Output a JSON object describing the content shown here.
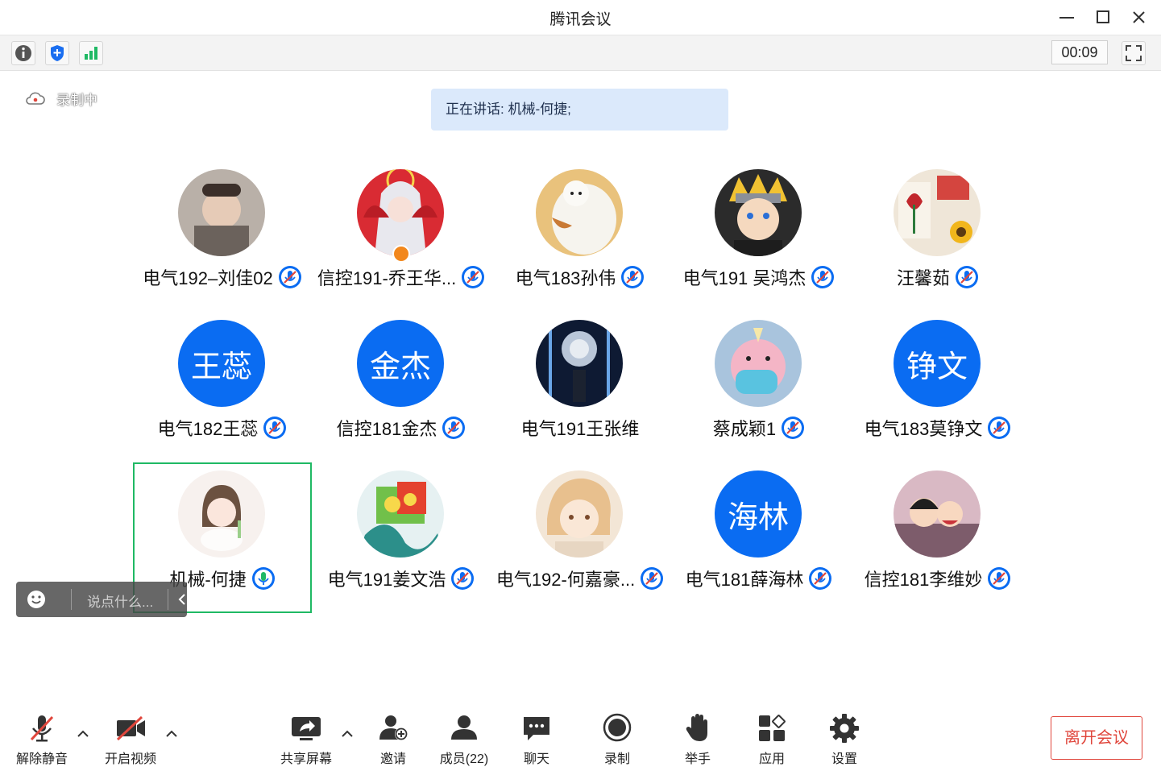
{
  "window": {
    "title": "腾讯会议"
  },
  "infobar": {
    "timer": "00:09"
  },
  "recording": {
    "label": "录制中"
  },
  "speaking": {
    "text": "正在讲话: 机械-何捷;"
  },
  "participants": [
    {
      "name": "电气192–刘佳02",
      "initials": "",
      "mic": "muted"
    },
    {
      "name": "信控191-乔王华...",
      "initials": "",
      "mic": "muted"
    },
    {
      "name": "电气183孙伟",
      "initials": "",
      "mic": "muted"
    },
    {
      "name": "电气191 吴鸿杰",
      "initials": "",
      "mic": "muted"
    },
    {
      "name": "汪馨茹",
      "initials": "",
      "mic": "muted"
    },
    {
      "name": "电气182王蕊",
      "initials": "王蕊",
      "mic": "muted"
    },
    {
      "name": "信控181金杰",
      "initials": "金杰",
      "mic": "muted"
    },
    {
      "name": "电气191王张维",
      "initials": "",
      "mic": "none"
    },
    {
      "name": "蔡成颖1",
      "initials": "",
      "mic": "muted"
    },
    {
      "name": "电气183莫铮文",
      "initials": "铮文",
      "mic": "muted"
    },
    {
      "name": "机械-何捷",
      "initials": "",
      "mic": "speaking"
    },
    {
      "name": "电气191姜文浩",
      "initials": "",
      "mic": "muted"
    },
    {
      "name": "电气192-何嘉豪...",
      "initials": "",
      "mic": "muted"
    },
    {
      "name": "电气181薛海林",
      "initials": "海林",
      "mic": "muted"
    },
    {
      "name": "信控181李维妙",
      "initials": "",
      "mic": "muted"
    }
  ],
  "chat": {
    "placeholder": "说点什么..."
  },
  "toolbar": {
    "unmute": "解除静音",
    "start_video": "开启视频",
    "share_screen": "共享屏幕",
    "invite": "邀请",
    "members": "成员(22)",
    "chat": "聊天",
    "record": "录制",
    "raise_hand": "举手",
    "apps": "应用",
    "settings": "设置",
    "leave": "离开会议"
  },
  "colors": {
    "accent_blue": "#0a6cf2",
    "active_speaker_border": "#1fb964",
    "leave_red": "#e0463c",
    "muted_red": "#e0463c"
  }
}
